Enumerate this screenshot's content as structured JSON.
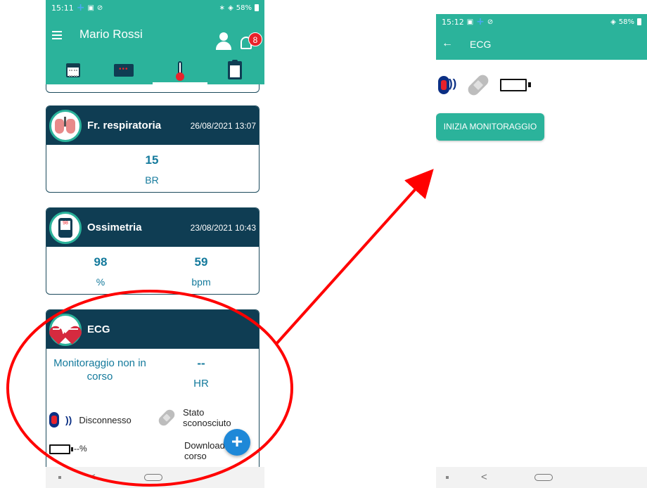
{
  "left_screen": {
    "status_bar": {
      "time": "15:11",
      "battery": "58%"
    },
    "header": {
      "user_name": "Mario Rossi",
      "notification_count": "8"
    },
    "tabs": [
      {
        "icon": "calendar-icon"
      },
      {
        "icon": "chat-icon"
      },
      {
        "icon": "thermometer-icon"
      },
      {
        "icon": "clipboard-icon"
      }
    ],
    "cards": {
      "respiration": {
        "title": "Fr. respiratoria",
        "date": "26/08/2021 13:07",
        "value": "15",
        "unit": "BR"
      },
      "oximetry": {
        "title": "Ossimetria",
        "date": "23/08/2021 10:43",
        "spo2_value": "98",
        "spo2_unit": "%",
        "pulse_value": "59",
        "pulse_unit": "bpm"
      },
      "ecg": {
        "title": "ECG",
        "status": "Monitoraggio non in corso",
        "hr_value": "--",
        "hr_unit": "HR",
        "connection": "Disconnesso",
        "sensor_state": "Stato sconosciuto",
        "battery": "--%",
        "download": "Download corso"
      }
    }
  },
  "right_screen": {
    "status_bar": {
      "time": "15:12",
      "battery": "58%"
    },
    "header": {
      "title": "ECG"
    },
    "start_button": "INIZIA MONITORAGGIO"
  },
  "colors": {
    "header": "#2bb39b",
    "card_header": "#0f3d53",
    "value": "#147a9c",
    "annotation": "#ff0000",
    "fab": "#1e88d8"
  }
}
